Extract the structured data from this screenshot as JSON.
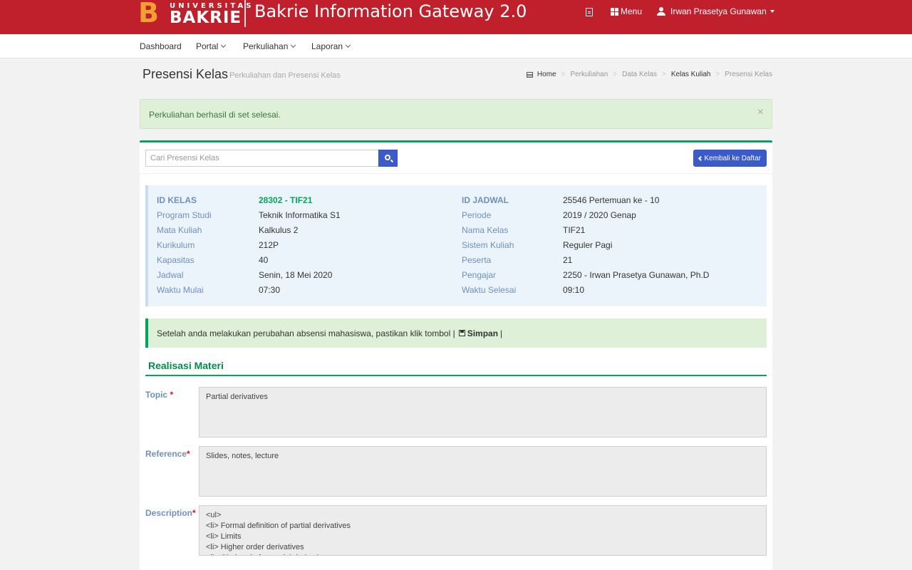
{
  "header": {
    "logo_small": "UNIVERSITAS",
    "logo_big": "BAKRIE",
    "app_title": "Bakrie Information Gateway 2.0",
    "menu_label": "Menu",
    "user_name": "Irwan Prasetya Gunawan",
    "icons": [
      "file-icon",
      "grid-icon",
      "user-icon"
    ]
  },
  "nav": {
    "items": [
      {
        "label": "Dashboard"
      },
      {
        "label": "Portal"
      },
      {
        "label": "Perkuliahan"
      },
      {
        "label": "Laporan"
      }
    ]
  },
  "page": {
    "title": "Presensi Kelas",
    "subtitle": "Perkuliahan dan Presensi Kelas",
    "breadcrumb": [
      "Home",
      "Perkuliahan",
      "Data Kelas",
      "Kelas Kuliah",
      "Presensi Kelas"
    ]
  },
  "alert": {
    "message": "Perkuliahan berhasil di set selesai.",
    "close": "×"
  },
  "toolbar": {
    "search_placeholder": "Cari Presensi Kelas",
    "back_label": "Kembali ke Daftar"
  },
  "info": {
    "left": [
      {
        "label": "ID KELAS",
        "value": "28302 - TIF21"
      },
      {
        "label": "Program Studi",
        "value": "Teknik Informatika S1"
      },
      {
        "label": "Mata Kuliah",
        "value": "Kalkulus 2"
      },
      {
        "label": "Kurikulum",
        "value": "212P"
      },
      {
        "label": "Kapasitas",
        "value": "40"
      },
      {
        "label": "Jadwal",
        "value": "Senin, 18 Mei 2020"
      },
      {
        "label": "Waktu Mulai",
        "value": "07:30"
      }
    ],
    "right": [
      {
        "label": "ID JADWAL",
        "value": "25546 Pertemuan ke - 10"
      },
      {
        "label": "Periode",
        "value": "2019 / 2020 Genap"
      },
      {
        "label": "Nama Kelas",
        "value": "TIF21"
      },
      {
        "label": "Sistem Kuliah",
        "value": "Reguler Pagi"
      },
      {
        "label": "Peserta",
        "value": "21"
      },
      {
        "label": "Pengajar",
        "value": "2250 - Irwan Prasetya Gunawan, Ph.D"
      },
      {
        "label": "Waktu Selesai",
        "value": "09:10"
      }
    ]
  },
  "notice": {
    "text": "Setelah anda melakukan perubahan absensi mahasiswa, pastikan klik tombol |",
    "button_word": "Simpan",
    "tail": "|"
  },
  "section": {
    "title": "Realisasi Materi"
  },
  "form": {
    "topic_label": "Topic",
    "topic_value": "Partial derivatives",
    "reference_label": "Reference",
    "reference_value": "Slides, notes, lecture",
    "description_label": "Description",
    "description_value": "<ul>\n<li> Formal definition of partial derivatives\n<li> Limits\n<li> Higher order derivatives\n<li> Chain rule for partial derivatives",
    "required_mark": "*"
  },
  "colors": {
    "brand_red": "#c0202c",
    "accent_green": "#00a65a",
    "button_blue": "#3c5bcb",
    "label_blue": "#6f8fbd"
  }
}
